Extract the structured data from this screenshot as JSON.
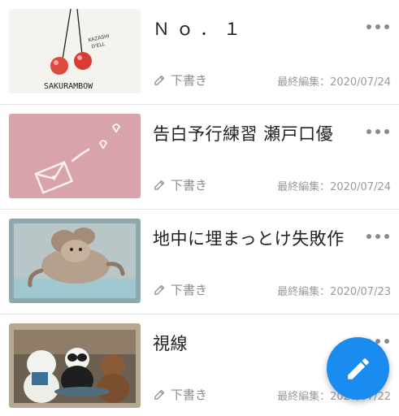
{
  "notes": [
    {
      "title": "Ｎｏ．１",
      "draft_label": "下書き",
      "edited_label": "最終編集：2020/07/24",
      "thumbnail": "cherries-sakurambow-image",
      "thumbnail_text": "SAKURAMBOW"
    },
    {
      "title": "告白予行練習 瀬戸口優",
      "draft_label": "下書き",
      "edited_label": "最終編集：2020/07/24",
      "thumbnail": "pink-envelope-hearts-image"
    },
    {
      "title": "地中に埋まっとけ失敗作",
      "draft_label": "下書き",
      "edited_label": "最終編集：2020/07/23",
      "thumbnail": "cartoon-mouse-image"
    },
    {
      "title": "視線",
      "draft_label": "下書き",
      "edited_label": "最終編集：2020/07/22",
      "thumbnail": "three-bears-cartoon-image"
    }
  ],
  "fab": {
    "icon": "pencil-icon",
    "color": "#1a8cf0"
  },
  "colors": {
    "title": "#222222",
    "meta": "#9a9a9a",
    "divider": "#e2e2e2"
  }
}
